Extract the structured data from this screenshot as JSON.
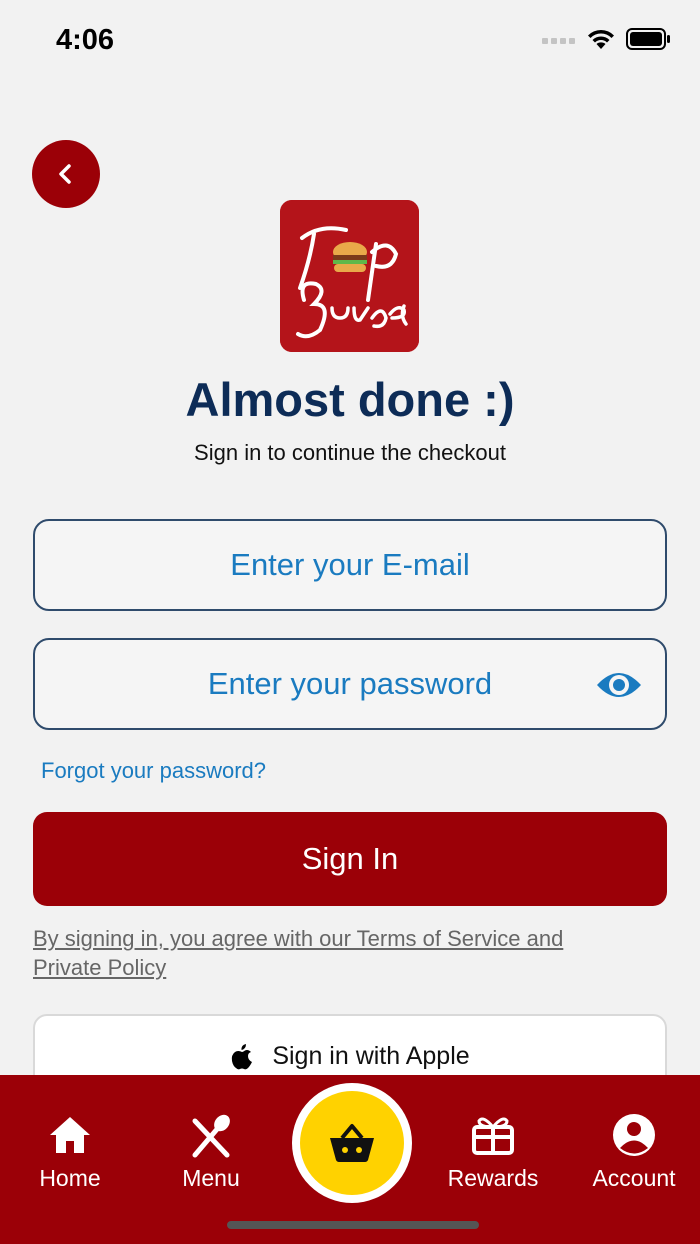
{
  "status_bar": {
    "time": "4:06",
    "icons": [
      "signal-icon",
      "wifi-icon",
      "battery-icon"
    ]
  },
  "header": {
    "back_icon": "chevron-left-icon",
    "logo_text": "Top Burger"
  },
  "main": {
    "title": "Almost done :)",
    "subtitle": "Sign in to continue the checkout",
    "email_placeholder": "Enter your E-mail",
    "password_placeholder": "Enter your password",
    "password_toggle_icon": "eye-icon",
    "forgot_password": "Forgot your password?",
    "sign_in": "Sign In",
    "terms_line1": "By signing in, you agree with our Terms of Service and",
    "terms_line2": "Private Policy",
    "apple_sign_in": "Sign in with Apple"
  },
  "bottom_nav": {
    "items": [
      {
        "label": "Home",
        "icon": "home-icon"
      },
      {
        "label": "Menu",
        "icon": "cutlery-icon"
      },
      {
        "label": "Rewards",
        "icon": "gift-icon"
      },
      {
        "label": "Account",
        "icon": "account-icon"
      }
    ],
    "cart_icon": "basket-icon"
  },
  "colors": {
    "brand_red": "#9b0007",
    "title_navy": "#0d2c57",
    "link_blue": "#1a7bc0",
    "cart_yellow": "#ffd200"
  }
}
